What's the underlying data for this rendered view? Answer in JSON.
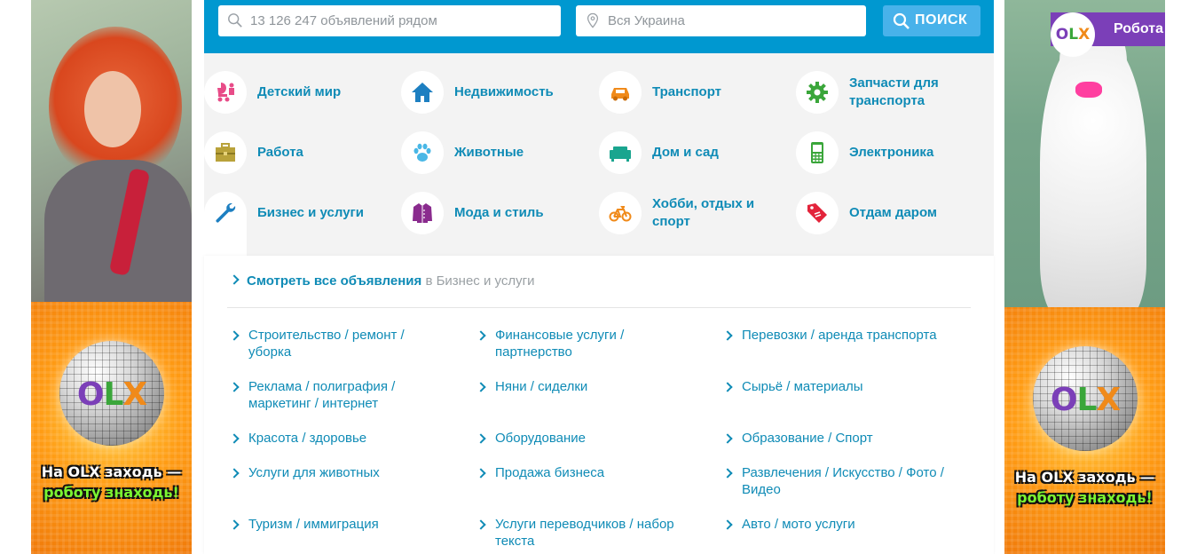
{
  "search": {
    "query_placeholder": "13 126 247 объявлений рядом",
    "location_placeholder": "Вся Украина",
    "button_label": "ПОИСК"
  },
  "categories": [
    {
      "label": "Детский мир",
      "icon": "stroller-icon",
      "color": "#e84c88"
    },
    {
      "label": "Недвижимость",
      "icon": "house-icon",
      "color": "#1d7fc1"
    },
    {
      "label": "Транспорт",
      "icon": "car-icon",
      "color": "#f08a1a"
    },
    {
      "label": "Запчасти для транспорта",
      "icon": "gear-icon",
      "color": "#3aa63a"
    },
    {
      "label": "Работа",
      "icon": "briefcase-icon",
      "color": "#b9a23a"
    },
    {
      "label": "Животные",
      "icon": "paw-icon",
      "color": "#49b7e6"
    },
    {
      "label": "Дом и сад",
      "icon": "sofa-icon",
      "color": "#1aa58f"
    },
    {
      "label": "Электроника",
      "icon": "phone-icon",
      "color": "#3aa63a"
    },
    {
      "label": "Бизнес и услуги",
      "icon": "wrench-icon",
      "color": "#1d7fc1"
    },
    {
      "label": "Мода и стиль",
      "icon": "jacket-icon",
      "color": "#8a2b8e"
    },
    {
      "label": "Хобби, отдых и спорт",
      "icon": "bicycle-icon",
      "color": "#f08a1a"
    },
    {
      "label": "Отдам даром",
      "icon": "price-tag-icon",
      "color": "#e3243b"
    }
  ],
  "subcategories": {
    "view_all_link": "Смотреть все объявления",
    "view_all_suffix": "в Бизнес и услуги",
    "items": [
      "Строительство / ремонт / уборка",
      "Финансовые услуги / партнерство",
      "Перевозки / аренда транспорта",
      "Реклама / полиграфия / маркетинг / интернет",
      "Няни / сиделки",
      "Сырьё / материалы",
      "Красота / здоровье",
      "Оборудование",
      "Образование / Спорт",
      "Услуги для животных",
      "Продажа бизнеса",
      "Развлечения / Искусство / Фото / Видео",
      "Туризм / иммиграция",
      "Услуги переводчиков / набор текста",
      "Авто / мото услуги"
    ]
  },
  "banners": {
    "slogan_line1": "На OLX заходь —",
    "slogan_line2": "роботу знаходь!",
    "logo_o": "O",
    "logo_l": "L",
    "logo_x": "X",
    "badge_label": "Робота"
  }
}
